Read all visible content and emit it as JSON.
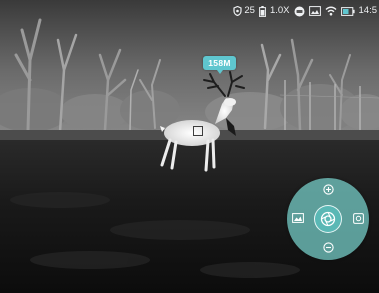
{
  "status_bar": {
    "shield_count": "25",
    "zoom": "1.0X",
    "time": "14:5"
  },
  "overlay": {
    "target_distance": "158M"
  },
  "icons": {
    "status": [
      "shield-icon",
      "battery-level-icon",
      "record-icon",
      "image-mode-icon",
      "wifi-icon",
      "battery-icon"
    ],
    "wheel": [
      "zoom-in-icon",
      "zoom-out-icon",
      "gallery-icon",
      "mode-icon",
      "shutter-icon"
    ]
  },
  "colors": {
    "accent": "#5fc6cf",
    "wheel": "#78d2cd",
    "status_text": "#eef0f2"
  }
}
